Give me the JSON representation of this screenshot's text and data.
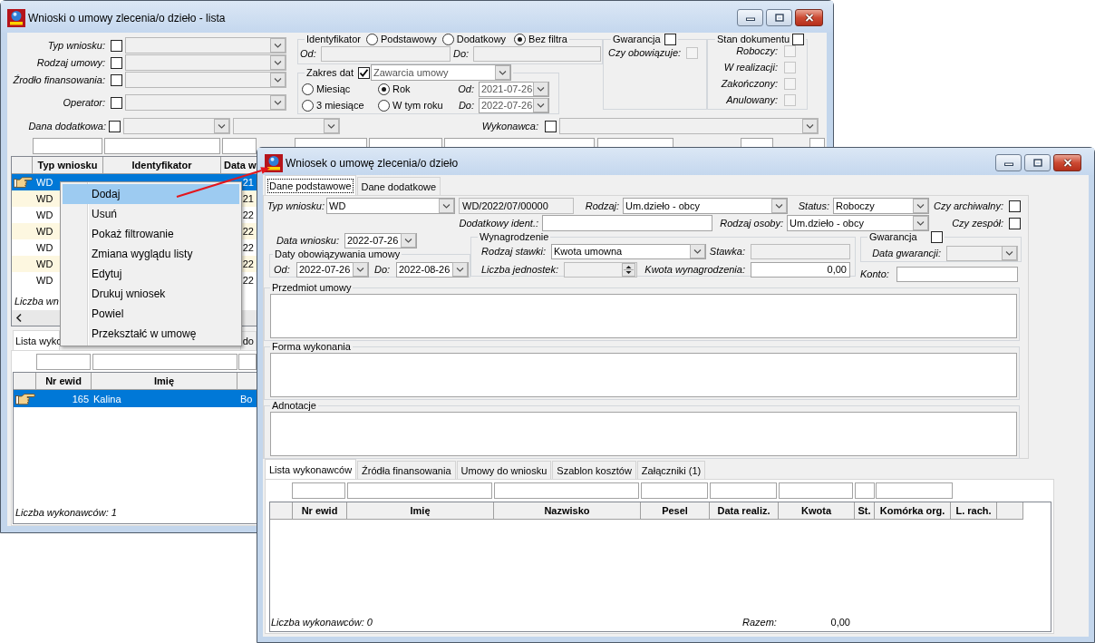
{
  "back_window": {
    "title": "Wnioski o umowy zlecenia/o dzieło - lista",
    "filters": [
      {
        "label": "Typ wniosku:",
        "checked": false
      },
      {
        "label": "Rodzaj umowy:",
        "checked": false
      },
      {
        "label": "Źrodło finansowania:",
        "checked": false
      },
      {
        "label": "Operator:",
        "checked": false
      }
    ],
    "identifier_filter": {
      "title": "Identyfikator",
      "options": [
        {
          "label": "Podstawowy",
          "selected": false
        },
        {
          "label": "Dodatkowy",
          "selected": false
        },
        {
          "label": "Bez filtra",
          "selected": true
        }
      ],
      "from_label": "Od:",
      "to_label": "Do:",
      "fields_disabled": true
    },
    "date_range": {
      "title": "Zakres dat",
      "checked": true,
      "basis": "Zawarcia umowy",
      "options": [
        {
          "label": "Miesiąc",
          "selected": false
        },
        {
          "label": "Rok",
          "selected": true
        },
        {
          "label": "3 miesiące",
          "selected": false
        },
        {
          "label": "W tym roku",
          "selected": false
        }
      ],
      "from_label": "Od:",
      "from": "2021-07-26",
      "to_label": "Do:",
      "to": "2022-07-26"
    },
    "guarantee": {
      "title": "Gwarancja",
      "checked": false,
      "items": [
        {
          "label": "Czy obowiązuje:",
          "checked": false,
          "disabled": true
        }
      ]
    },
    "document_state": {
      "title": "Stan dokumentu",
      "checked": false,
      "items": [
        {
          "label": "Roboczy:",
          "checked": false,
          "disabled": true
        },
        {
          "label": "W realizacji:",
          "checked": false,
          "disabled": true
        },
        {
          "label": "Zakończony:",
          "checked": false,
          "disabled": true
        },
        {
          "label": "Anulowany:",
          "checked": false,
          "disabled": true
        }
      ]
    },
    "extra_data_filter": {
      "label": "Dana dodatkowa:",
      "checked": false
    },
    "contractor_filter": {
      "label": "Wykonawca:",
      "checked": false
    },
    "table": {
      "columns": [
        "Typ wniosku",
        "Identyfikator",
        "Data w"
      ],
      "rows": [
        {
          "selected": true,
          "typ_wniosku": "WD",
          "data_w": "21"
        },
        {
          "selected": false,
          "typ_wniosku": "WD",
          "data_w": "21"
        },
        {
          "selected": false,
          "typ_wniosku": "WD",
          "data_w": "22"
        },
        {
          "selected": false,
          "typ_wniosku": "WD",
          "data_w": "22"
        },
        {
          "selected": false,
          "typ_wniosku": "WD",
          "data_w": "22"
        },
        {
          "selected": false,
          "typ_wniosku": "WD",
          "data_w": "22"
        },
        {
          "selected": false,
          "typ_wniosku": "WD",
          "data_w": "22"
        }
      ]
    },
    "count_label": "Liczba wn",
    "tabs": [
      {
        "label": "Lista wyko",
        "selected": true
      },
      {
        "label": "do",
        "selected": false
      }
    ],
    "contractors": {
      "columns": [
        "Nr ewid",
        "Imię"
      ],
      "rows": [
        {
          "selected": true,
          "nr_ewid": "165",
          "imie": "Kalina",
          "column_3": "Bo"
        }
      ],
      "count_label": "Liczba wykonawców: 1"
    }
  },
  "context_menu": {
    "items": [
      {
        "label": "Dodaj",
        "selected": true
      },
      {
        "label": "Usuń",
        "selected": false
      },
      {
        "label": "Pokaż filtrowanie",
        "selected": false
      },
      {
        "label": "Zmiana wyglądu listy",
        "selected": false
      },
      {
        "label": "Edytuj",
        "selected": false
      },
      {
        "label": "Drukuj wniosek",
        "selected": false
      },
      {
        "label": "Powiel",
        "selected": false
      },
      {
        "label": "Przekształć w umowę",
        "selected": false
      }
    ]
  },
  "front_window": {
    "title": "Wniosek o umowę zlecenia/o dzieło",
    "tabs": [
      {
        "label": "Dane podstawowe",
        "selected": true
      },
      {
        "label": "Dane dodatkowe",
        "selected": false
      }
    ],
    "request_type": {
      "label": "Typ wniosku:",
      "value": "WD"
    },
    "identifier": {
      "value": "WD/2022/07/00000",
      "disabled": true
    },
    "contract_kind": {
      "label": "Rodzaj:",
      "value": "Um.dzieło - obcy"
    },
    "status": {
      "label": "Status:",
      "value": "Roboczy"
    },
    "archived": {
      "label": "Czy archiwalny:",
      "checked": false
    },
    "extra_identifier": {
      "label": "Dodatkowy ident.:"
    },
    "person_kind": {
      "label": "Rodzaj osoby:",
      "value": "Um.dzieło - obcy"
    },
    "team": {
      "label": "Czy zespół:",
      "checked": false
    },
    "request_date": {
      "label": "Data wniosku:",
      "value": "2022-07-26"
    },
    "validity": {
      "title": "Daty obowiązywania umowy",
      "from_label": "Od:",
      "from": "2022-07-26",
      "to_label": "Do:",
      "to": "2022-08-26"
    },
    "remuneration": {
      "title": "Wynagrodzenie",
      "rate_type": {
        "label": "Rodzaj stawki:",
        "value": "Kwota umowna"
      },
      "rate": {
        "label": "Stawka:",
        "disabled": true
      },
      "units": {
        "label": "Liczba jednostek:",
        "disabled": true
      },
      "amount": {
        "label": "Kwota wynagrodzenia:",
        "value": "0,00"
      }
    },
    "guarantee": {
      "title": "Gwarancja",
      "checked": false,
      "date_label": "Data gwarancji:"
    },
    "account": {
      "label": "Konto:"
    },
    "text_sections": [
      {
        "title": "Przedmiot umowy"
      },
      {
        "title": "Forma wykonania"
      },
      {
        "title": "Adnotacje"
      }
    ],
    "bottom_tabs": [
      {
        "label": "Lista wykonawców",
        "selected": true
      },
      {
        "label": "Źródła finansowania",
        "selected": false
      },
      {
        "label": "Umowy do wniosku",
        "selected": false
      },
      {
        "label": "Szablon kosztów",
        "selected": false
      },
      {
        "label": "Załączniki (1)",
        "selected": false
      }
    ],
    "contractors_table": {
      "columns": [
        "Nr ewid",
        "Imię",
        "Nazwisko",
        "Pesel",
        "Data realiz.",
        "Kwota",
        "St.",
        "Komórka org.",
        "L. rach."
      ]
    },
    "count_label": "Liczba wykonawców: 0",
    "total_label": "Razem:",
    "total": "0,00"
  }
}
